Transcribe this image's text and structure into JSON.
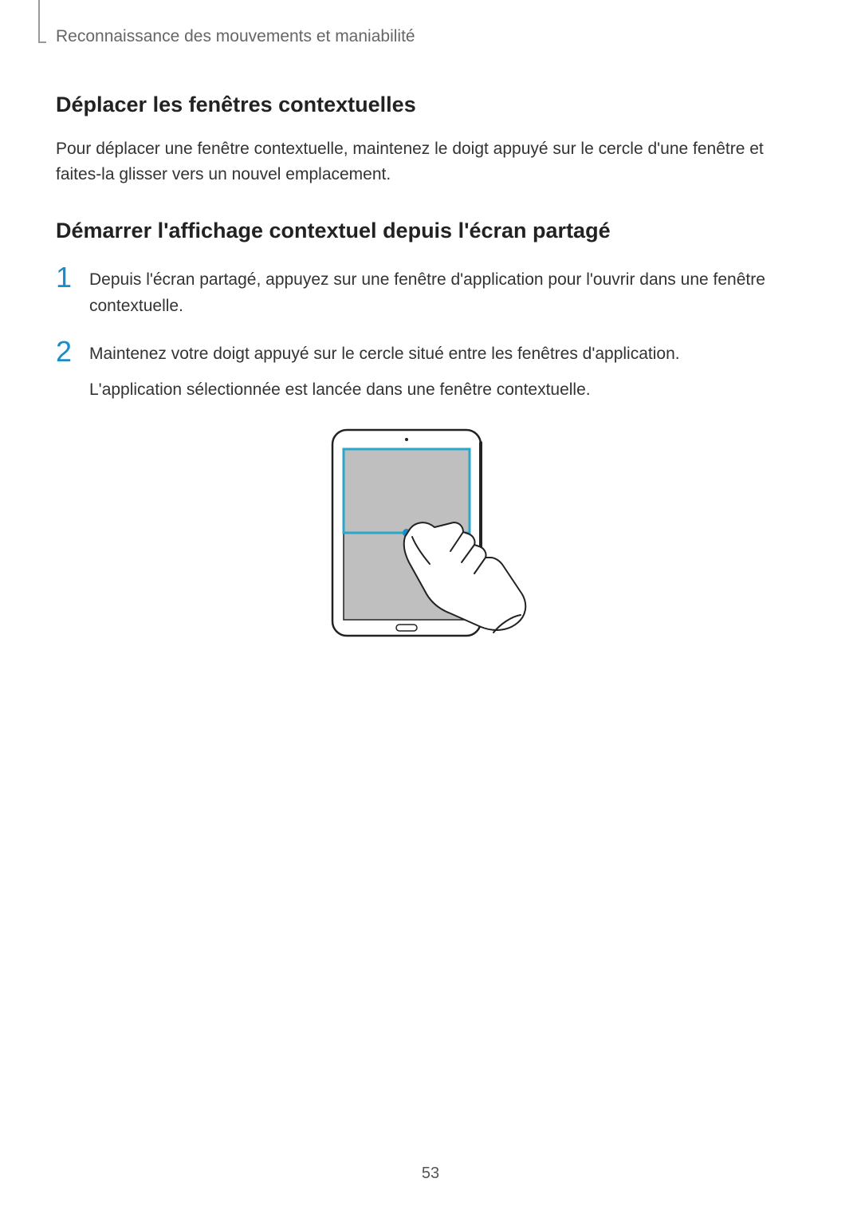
{
  "header": {
    "breadcrumb": "Reconnaissance des mouvements et maniabilité"
  },
  "section1": {
    "title": "Déplacer les fenêtres contextuelles",
    "paragraph": "Pour déplacer une fenêtre contextuelle, maintenez le doigt appuyé sur le cercle d'une fenêtre et faites-la glisser vers un nouvel emplacement."
  },
  "section2": {
    "title": "Démarrer l'affichage contextuel depuis l'écran partagé",
    "steps": [
      {
        "num": "1",
        "text": "Depuis l'écran partagé, appuyez sur une fenêtre d'application pour l'ouvrir dans une fenêtre contextuelle."
      },
      {
        "num": "2",
        "text": "Maintenez votre doigt appuyé sur le cercle situé entre les fenêtres d'application.",
        "sub": "L'application sélectionnée est lancée dans une fenêtre contextuelle."
      }
    ]
  },
  "pageNumber": "53"
}
